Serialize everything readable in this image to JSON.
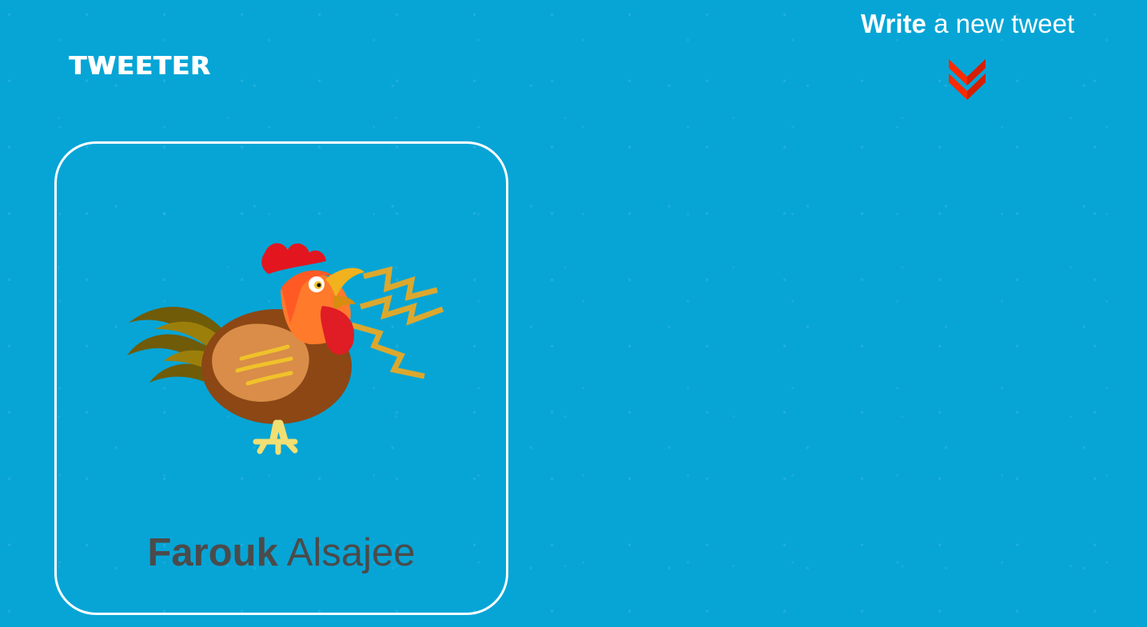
{
  "header": {
    "logo_text": "TWEETER"
  },
  "compose": {
    "strong_text": "Write",
    "light_text": " a new tweet",
    "arrow_icon": "double-chevron-down-icon"
  },
  "profile": {
    "avatar_icon": "rooster-icon",
    "first_name": "Farouk",
    "last_name": "Alsajee"
  },
  "colors": {
    "background": "#06a5d6",
    "arrow": "#ff2a00",
    "name_text": "#4b4b4b",
    "card_border": "#ffffff"
  }
}
